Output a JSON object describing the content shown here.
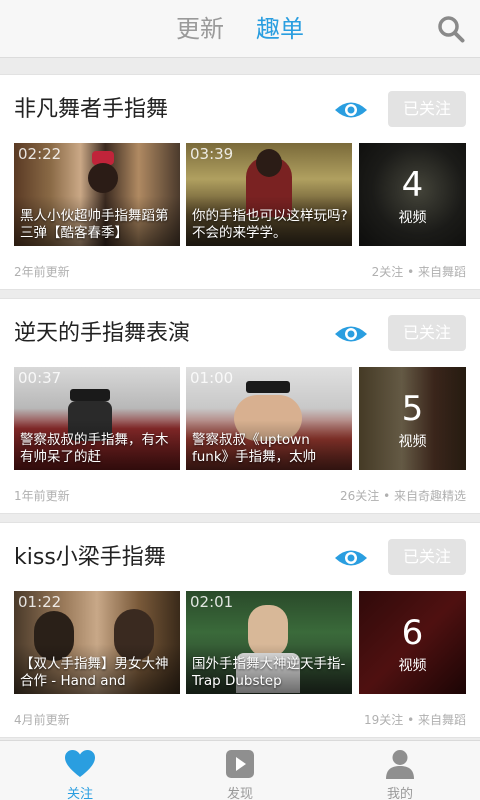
{
  "header": {
    "tabs": [
      {
        "label": "更新"
      },
      {
        "label": "趣单"
      }
    ]
  },
  "colors": {
    "accent": "#2a9ee0",
    "follow_button_bg": "#e3e3e3"
  },
  "cards": [
    {
      "title": "非凡舞者手指舞",
      "follow_label": "已关注",
      "updated": "2年前更新",
      "meta": "2关注 • 来自舞蹈",
      "videos": [
        {
          "duration": "02:22",
          "title": "黑人小伙超帅手指舞蹈第三弹【酷客春季】"
        },
        {
          "duration": "03:39",
          "title": "你的手指也可以这样玩吗?不会的来学学。"
        }
      ],
      "more": {
        "count": "4",
        "label": "视频"
      }
    },
    {
      "title": "逆天的手指舞表演",
      "follow_label": "已关注",
      "updated": "1年前更新",
      "meta": "26关注 • 来自奇趣精选",
      "videos": [
        {
          "duration": "00:37",
          "title": "警察叔叔的手指舞，有木有帅呆了的赶"
        },
        {
          "duration": "01:00",
          "title": "警察叔叔《uptown funk》手指舞，太帅"
        }
      ],
      "more": {
        "count": "5",
        "label": "视频"
      }
    },
    {
      "title": "kiss小梁手指舞",
      "follow_label": "已关注",
      "updated": "4月前更新",
      "meta": "19关注 • 来自舞蹈",
      "videos": [
        {
          "duration": "01:22",
          "title": "【双人手指舞】男女大神合作 - Hand and"
        },
        {
          "duration": "02:01",
          "title": "国外手指舞大神逆天手指- Trap Dubstep"
        }
      ],
      "more": {
        "count": "6",
        "label": "视频"
      }
    }
  ],
  "bottom_nav": [
    {
      "label": "关注",
      "icon": "heart-icon"
    },
    {
      "label": "发现",
      "icon": "play-icon"
    },
    {
      "label": "我的",
      "icon": "person-icon"
    }
  ]
}
